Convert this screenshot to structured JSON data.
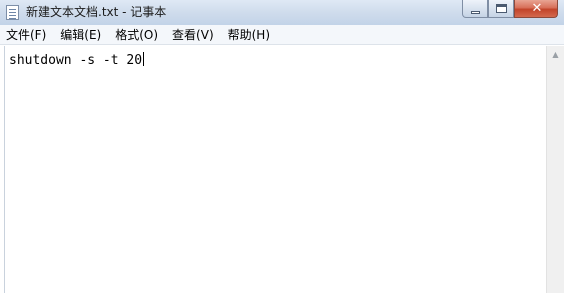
{
  "window": {
    "title": "新建文本文档.txt - 记事本",
    "app_icon": "notepad-icon",
    "caption": {
      "minimize_icon": "minimize-icon",
      "maximize_icon": "maximize-icon",
      "close_icon": "close-icon",
      "close_glyph": "✕"
    }
  },
  "menu": {
    "items": [
      {
        "label": "文件(F)"
      },
      {
        "label": "编辑(E)"
      },
      {
        "label": "格式(O)"
      },
      {
        "label": "查看(V)"
      },
      {
        "label": "帮助(H)"
      }
    ]
  },
  "editor": {
    "content": "shutdown -s -t 20"
  },
  "scrollbar": {
    "up_arrow": "▲",
    "up_icon": "scroll-up-arrow-icon"
  },
  "colors": {
    "titlebar": "#cfdcec",
    "close_button": "#c2442a",
    "menubar": "#f4f7fb"
  }
}
